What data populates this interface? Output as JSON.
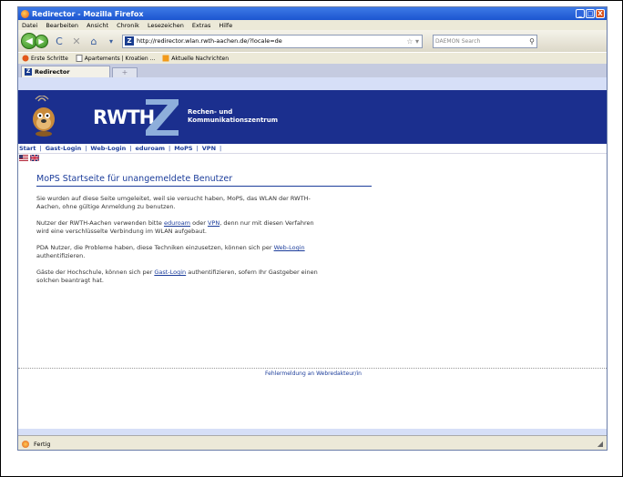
{
  "window": {
    "title": "Redirector - Mozilla Firefox",
    "buttons": [
      "_",
      "□",
      "X"
    ]
  },
  "menu": [
    "Datei",
    "Bearbeiten",
    "Ansicht",
    "Chronik",
    "Lesezeichen",
    "Extras",
    "Hilfe"
  ],
  "toolbar": {
    "url": "http://redirector.wlan.rwth-aachen.de/?locale=de",
    "search_placeholder": "DAEMON Search"
  },
  "bookmarks": [
    "Erste Schritte",
    "Apartements | Kroatien ...",
    "Aktuelle Nachrichten"
  ],
  "tab": {
    "label": "Redirector",
    "plus": "+"
  },
  "banner": {
    "logo": "RWTH",
    "subtitle_line1": "Rechen- und",
    "subtitle_line2": "Kommunikationszentrum"
  },
  "nav": [
    "Start",
    "Gast-Login",
    "Web-Login",
    "eduroam",
    "MoPS",
    "VPN"
  ],
  "page": {
    "heading": "MoPS Startseite für unangemeldete Benutzer",
    "p1": "Sie wurden auf diese Seite umgeleitet, weil sie versucht haben, MoPS, das WLAN der RWTH-Aachen, ohne gültige Anmeldung zu benutzen.",
    "p2_pre": "Nutzer der RWTH-Aachen verwenden bitte ",
    "p2_link1": "eduroam",
    "p2_mid": " oder ",
    "p2_link2": "VPN",
    "p2_post": ", denn nur mit diesen Verfahren wird eine verschlüsselte Verbindung im WLAN aufgebaut.",
    "p3_pre": "PDA Nutzer, die Probleme haben, diese Techniken einzusetzen, können sich per ",
    "p3_link": "Web-Login",
    "p3_post": " authentifizieren.",
    "p4_pre": "Gäste der Hochschule, können sich per ",
    "p4_link": "Gast-Login",
    "p4_post": " authentifizieren, sofern Ihr Gastgeber einen solchen beantragt hat.",
    "footer": "Fehlermeldung an Webredakteur/in"
  },
  "status": {
    "text": "Fertig"
  }
}
